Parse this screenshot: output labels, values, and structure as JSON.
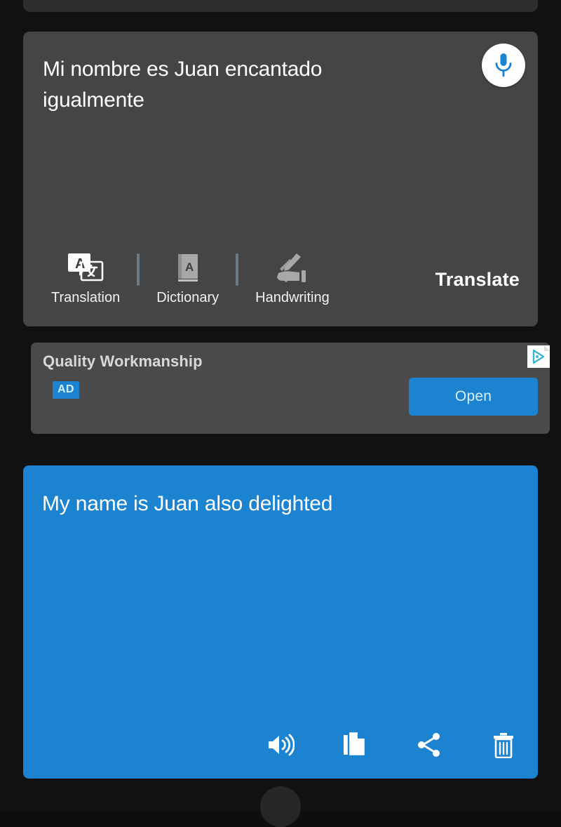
{
  "source_panel": {
    "text": "Mi nombre es Juan encantado igualmente",
    "mic_icon": "microphone-icon",
    "translate_action_label": "Translate",
    "tools": [
      {
        "label": "Translation",
        "icon": "translation-icon"
      },
      {
        "label": "Dictionary",
        "icon": "dictionary-book-icon"
      },
      {
        "label": "Handwriting",
        "icon": "handwriting-hand-pen-icon"
      }
    ]
  },
  "ad": {
    "title": "Quality Workmanship",
    "badge": "AD",
    "open_label": "Open",
    "adchoices_icon": "adchoices-icon"
  },
  "result_panel": {
    "text": "My name is Juan also delighted",
    "actions": [
      {
        "name": "speak-icon"
      },
      {
        "name": "copy-icon"
      },
      {
        "name": "share-icon"
      },
      {
        "name": "delete-icon"
      }
    ]
  },
  "colors": {
    "background": "#111111",
    "card": "#454545",
    "ad_card": "#4a4a4a",
    "accent_blue": "#1b83d0",
    "divider": "#6c7b85",
    "adchoices_teal": "#3fb6cf"
  }
}
